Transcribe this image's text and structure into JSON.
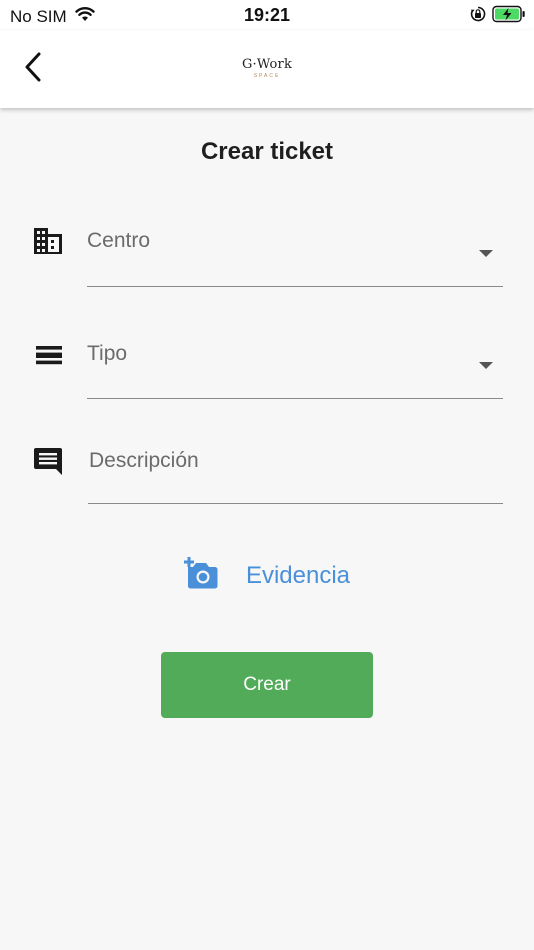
{
  "status_bar": {
    "carrier": "No SIM",
    "time": "19:21",
    "icons": [
      "wifi-icon",
      "orientation-lock-icon",
      "battery-charging-icon"
    ]
  },
  "header": {
    "back_icon": "chevron-left-icon",
    "logo_text": "G·Work",
    "logo_subtext": "SPACE"
  },
  "page": {
    "title": "Crear ticket"
  },
  "form": {
    "centro": {
      "label": "Centro",
      "icon": "building-icon"
    },
    "tipo": {
      "label": "Tipo",
      "icon": "list-icon"
    },
    "descripcion": {
      "label": "Descripción",
      "icon": "comment-icon"
    },
    "evidencia": {
      "label": "Evidencia",
      "icon": "add-camera-icon"
    },
    "submit_label": "Crear"
  },
  "colors": {
    "accent_blue": "#4a90d9",
    "button_green": "#52ab58",
    "battery_green": "#4cd964",
    "background": "#f7f7f7"
  }
}
